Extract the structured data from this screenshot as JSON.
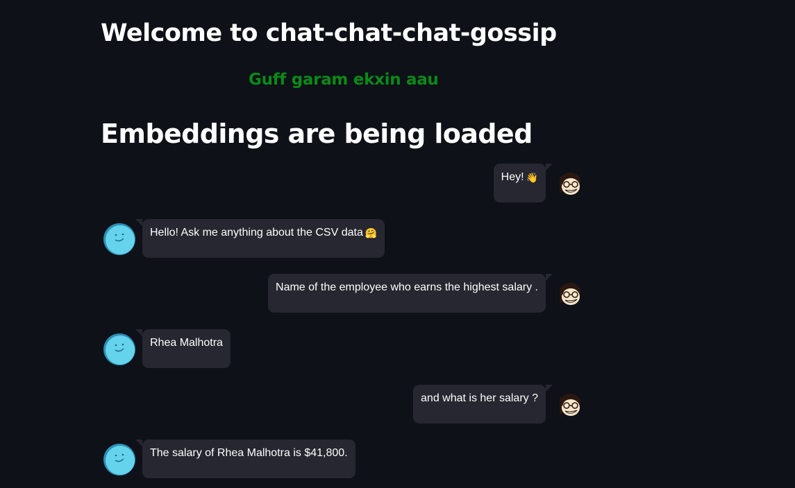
{
  "header": {
    "title": "Welcome to chat-chat-chat-gossip",
    "subtitle": "Guff garam ekxin aau",
    "status_heading": "Embeddings are being loaded"
  },
  "colors": {
    "background": "#0e1117",
    "bubble": "#262730",
    "subtitle": "#0a8a17",
    "bot_avatar": "#66d3ed"
  },
  "messages": [
    {
      "role": "user",
      "text": "Hey!",
      "emoji": "👋"
    },
    {
      "role": "bot",
      "text": "Hello! Ask me anything about the CSV data",
      "emoji": "🤗"
    },
    {
      "role": "user",
      "text": "Name of the employee who earns the highest salary ."
    },
    {
      "role": "bot",
      "text": "Rhea Malhotra"
    },
    {
      "role": "user",
      "text": "and what is her salary ?"
    },
    {
      "role": "bot",
      "text": "The salary of Rhea Malhotra is $41,800."
    }
  ],
  "icons": {
    "user_avatar": "user-avatar-icon",
    "bot_avatar": "bot-avatar-icon"
  }
}
